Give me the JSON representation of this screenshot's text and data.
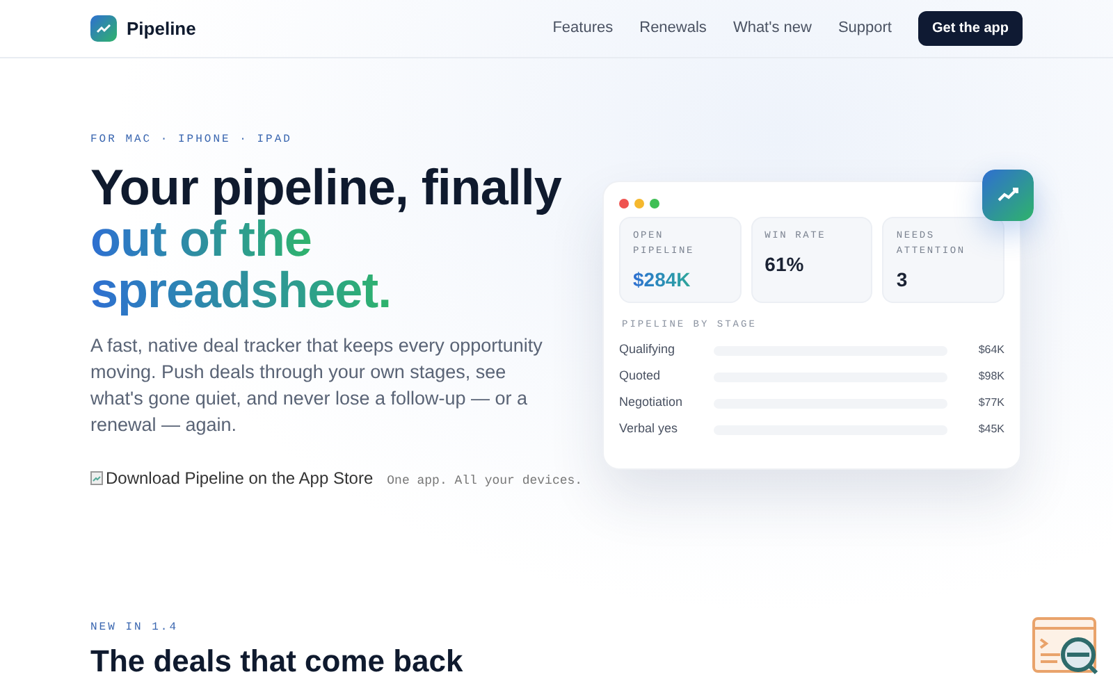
{
  "nav": {
    "brand": "Pipeline",
    "links": [
      "Features",
      "Renewals",
      "What's new",
      "Support"
    ],
    "cta": "Get the app"
  },
  "hero": {
    "eyebrow": "FOR MAC · IPHONE · IPAD",
    "title_lines": [
      {
        "text": "Your pipeline, finally",
        "kind": "plain"
      },
      {
        "text": "out of the",
        "kind": "gradient"
      },
      {
        "text": "spreadsheet.",
        "kind": "gradient"
      }
    ],
    "lead": "A fast, native deal tracker that keeps every opportunity moving. Push deals through your own stages, see what's gone quiet, and never lose a follow-up — or a renewal — again.",
    "store_badge_alt": "Download Pipeline on the App Store",
    "tagline": "One app. All your devices."
  },
  "preview": {
    "stats": [
      {
        "label": "OPEN PIPELINE",
        "value": "$284K",
        "kind": "accent"
      },
      {
        "label": "WIN RATE",
        "value": "61%",
        "kind": "plain"
      },
      {
        "label": "NEEDS ATTENTION",
        "value": "3",
        "kind": "plain"
      }
    ],
    "section_title": "PIPELINE BY STAGE",
    "stages": [
      {
        "name": "Qualifying",
        "amount": "$64K"
      },
      {
        "name": "Quoted",
        "amount": "$98K"
      },
      {
        "name": "Negotiation",
        "amount": "$77K"
      },
      {
        "name": "Verbal yes",
        "amount": "$45K"
      }
    ]
  },
  "next_section": {
    "eyebrow": "NEW IN 1.4",
    "title": "The deals that come back"
  }
}
